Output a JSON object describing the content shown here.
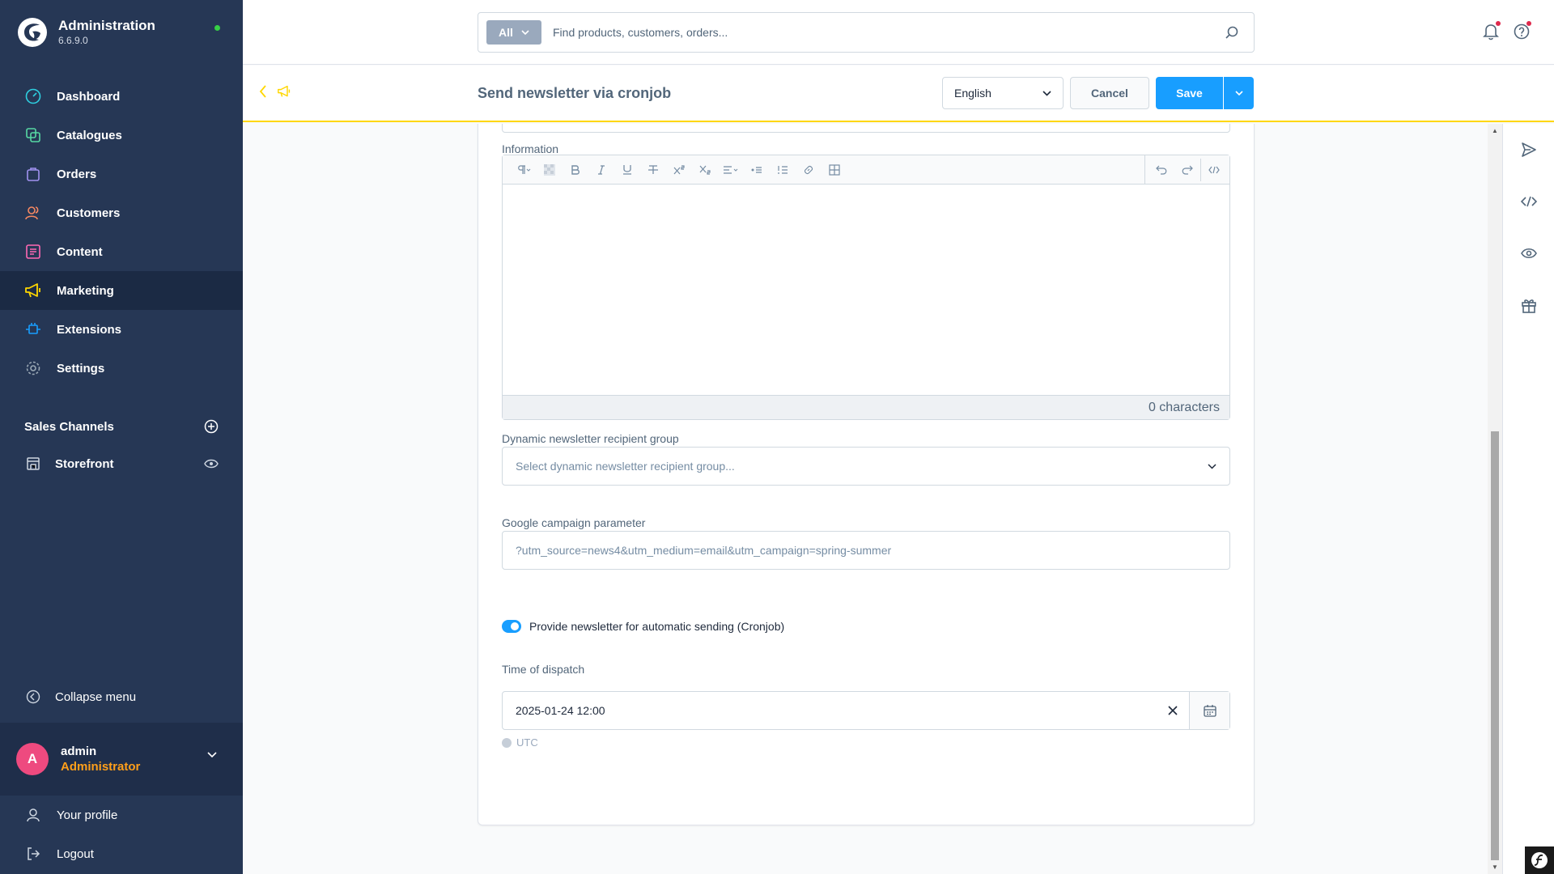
{
  "brand": {
    "title": "Administration",
    "version": "6.6.9.0"
  },
  "nav": {
    "items": [
      {
        "label": "Dashboard",
        "icon": "dashboard-icon",
        "color": "#2ecfe0"
      },
      {
        "label": "Catalogues",
        "icon": "catalogue-icon",
        "color": "#57d9a3"
      },
      {
        "label": "Orders",
        "icon": "orders-icon",
        "color": "#a092f0"
      },
      {
        "label": "Customers",
        "icon": "customers-icon",
        "color": "#f88962"
      },
      {
        "label": "Content",
        "icon": "content-icon",
        "color": "#ff68b4"
      },
      {
        "label": "Marketing",
        "icon": "marketing-icon",
        "color": "#ffd700"
      },
      {
        "label": "Extensions",
        "icon": "extensions-icon",
        "color": "#189eff"
      },
      {
        "label": "Settings",
        "icon": "settings-icon",
        "color": "#9aa8b5"
      }
    ],
    "active_index": 5
  },
  "sales_channels": {
    "header": "Sales Channels",
    "items": [
      {
        "label": "Storefront"
      }
    ]
  },
  "collapse_label": "Collapse menu",
  "user": {
    "initial": "A",
    "name": "admin",
    "role": "Administrator"
  },
  "bottom_links": {
    "profile": "Your profile",
    "logout": "Logout"
  },
  "search": {
    "type_label": "All",
    "placeholder": "Find products, customers, orders..."
  },
  "smartbar": {
    "title": "Send newsletter via cronjob",
    "language": "English",
    "cancel_label": "Cancel",
    "save_label": "Save"
  },
  "form": {
    "information_label": "Information",
    "char_count": "0 characters",
    "recipient_group_label": "Dynamic newsletter recipient group",
    "recipient_group_placeholder": "Select dynamic newsletter recipient group...",
    "campaign_label": "Google campaign parameter",
    "campaign_placeholder": "?utm_source=news4&utm_medium=email&utm_campaign=spring-summer",
    "cronjob_label": "Provide newsletter for automatic sending (Cronjob)",
    "cronjob_enabled": true,
    "dispatch_label": "Time of dispatch",
    "dispatch_value": "2025-01-24 12:00",
    "timezone": "UTC"
  },
  "colors": {
    "sidebar": "#263755",
    "accent": "#189eff",
    "marketing": "#ffd700"
  }
}
